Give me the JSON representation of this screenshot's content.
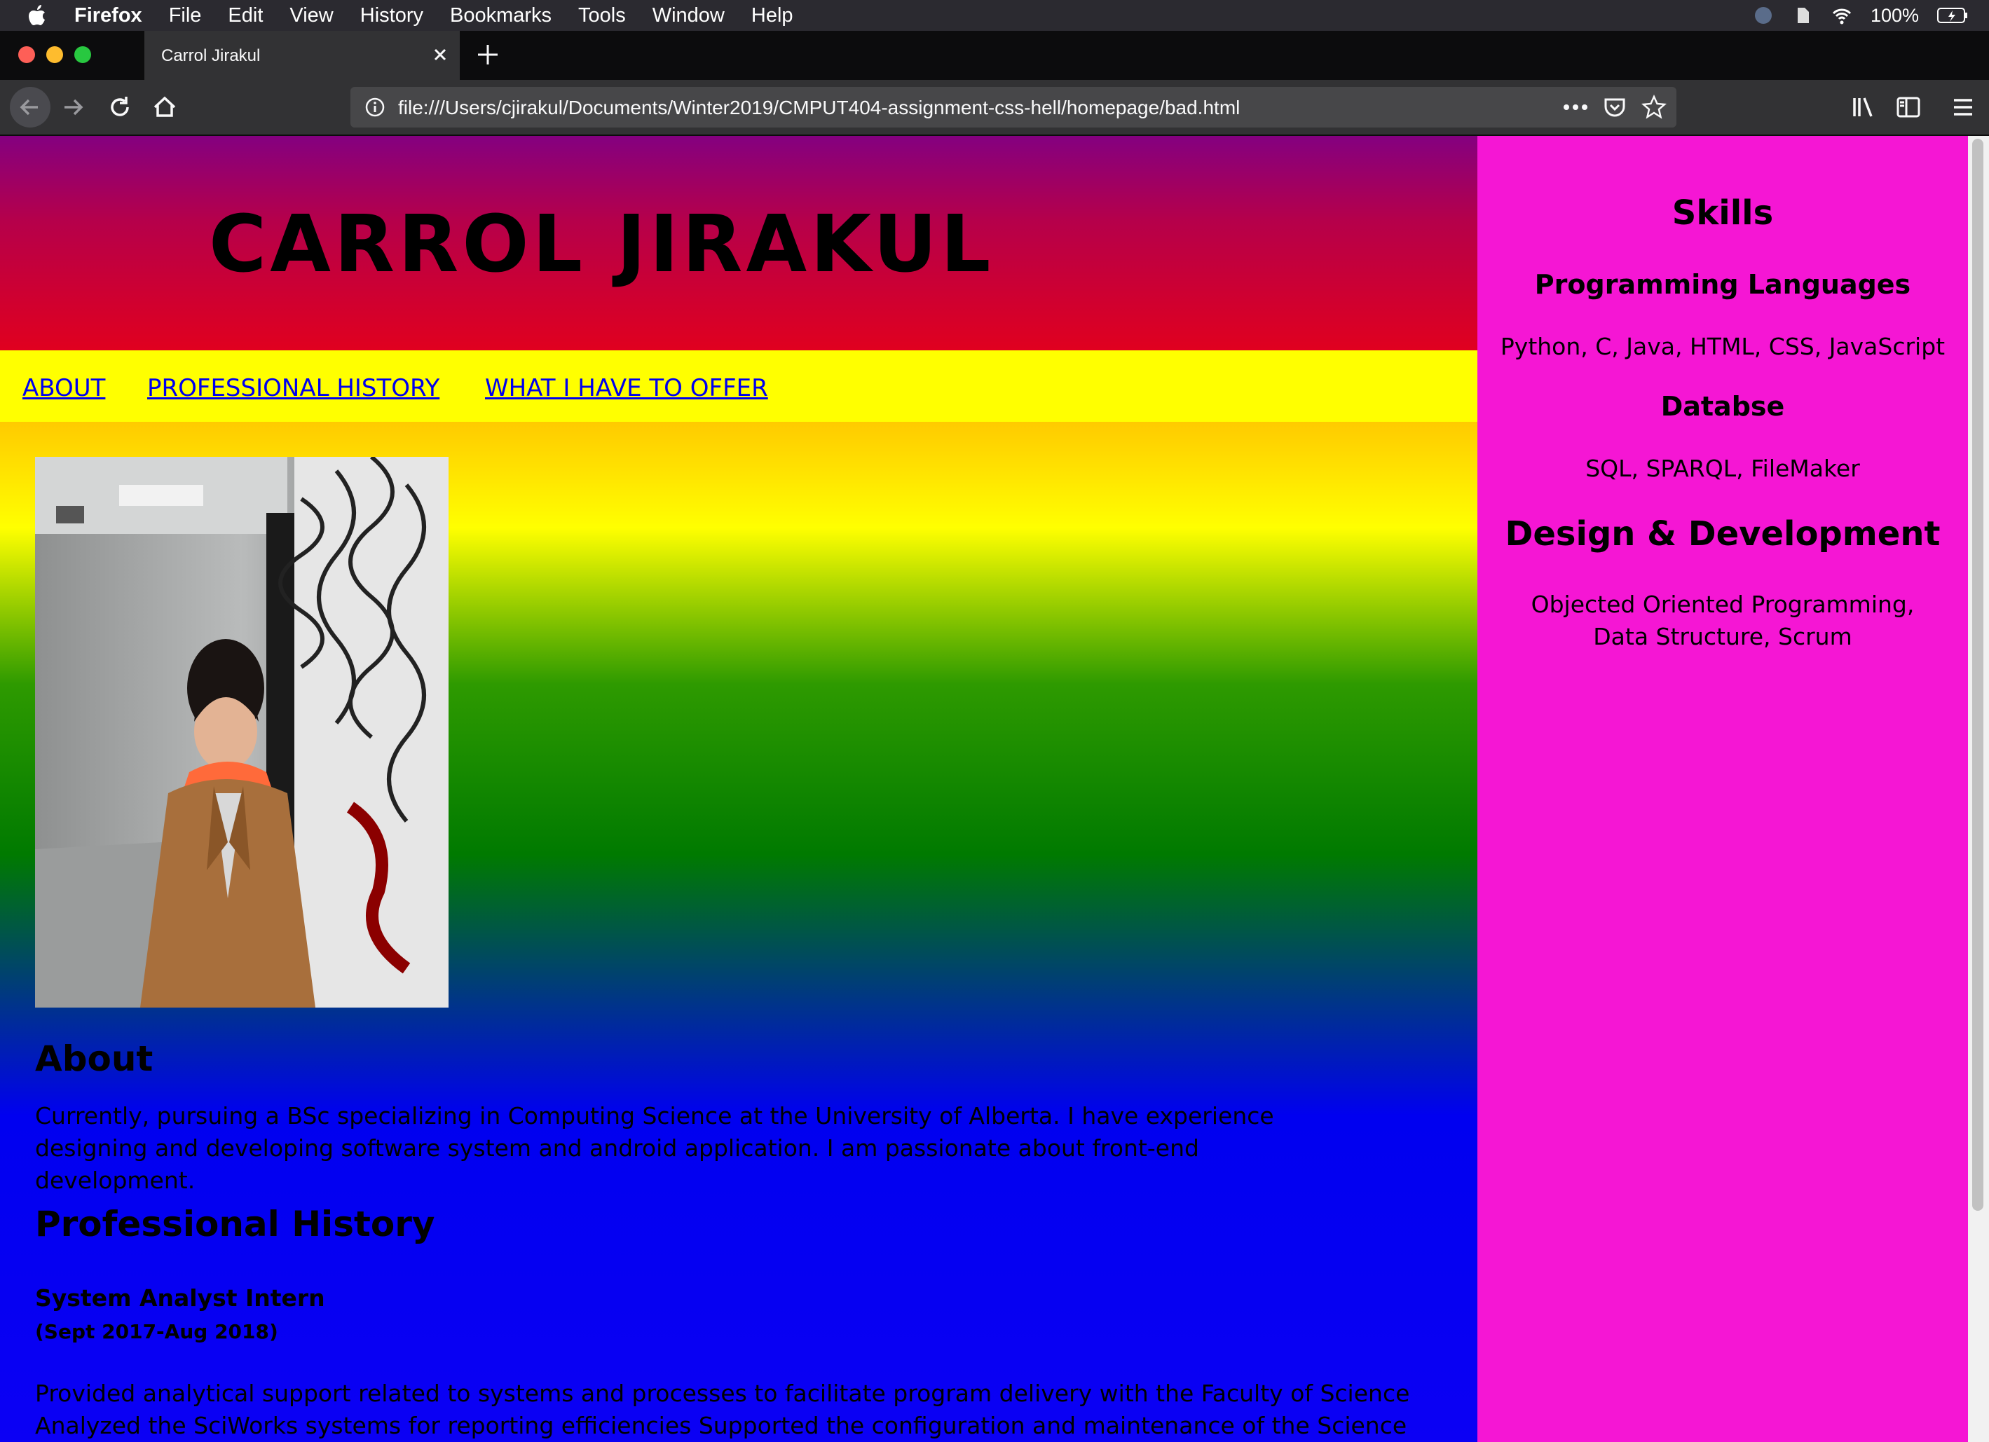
{
  "menubar": {
    "items": [
      "Firefox",
      "File",
      "Edit",
      "View",
      "History",
      "Bookmarks",
      "Tools",
      "Window",
      "Help"
    ],
    "battery": "100%"
  },
  "tab": {
    "title": "Carrol Jirakul"
  },
  "urlbar": {
    "url": "file:///Users/cjirakul/Documents/Winter2019/CMPUT404-assignment-css-hell/homepage/bad.html"
  },
  "page": {
    "title": "CARROL JIRAKUL",
    "nav": [
      "ABOUT",
      "PROFESSIONAL HISTORY",
      "WHAT I HAVE TO OFFER"
    ],
    "about_heading": "About",
    "about_text": "Currently, pursuing a BSc specializing in Computing Science at the University of Alberta. I have experience designing and developing software system and android application. I am passionate about front-end development.",
    "history_heading": "Professional History",
    "job_title": "System Analyst Intern",
    "job_dates": "(Sept 2017-Aug 2018)",
    "job_text": "Provided analytical support related to systems and processes to facilitate program delivery with the Faculty of Science Analyzed the SciWorks systems for reporting efficiencies Supported the configuration and maintenance of the Science Internship Program"
  },
  "sidebar": {
    "heading": "Skills",
    "sections": [
      {
        "heading": "Programming Languages",
        "text": "Python, C, Java, HTML, CSS, JavaScript"
      },
      {
        "heading": "Databse",
        "text": "SQL, SPARQL, FileMaker"
      },
      {
        "heading": "Design & Development",
        "text": "Objected Oriented Programming, Data Structure, Scrum"
      }
    ]
  },
  "colors": {
    "sidebar": "#f516d4",
    "nav": "#ffff00",
    "link": "#0000ee"
  }
}
